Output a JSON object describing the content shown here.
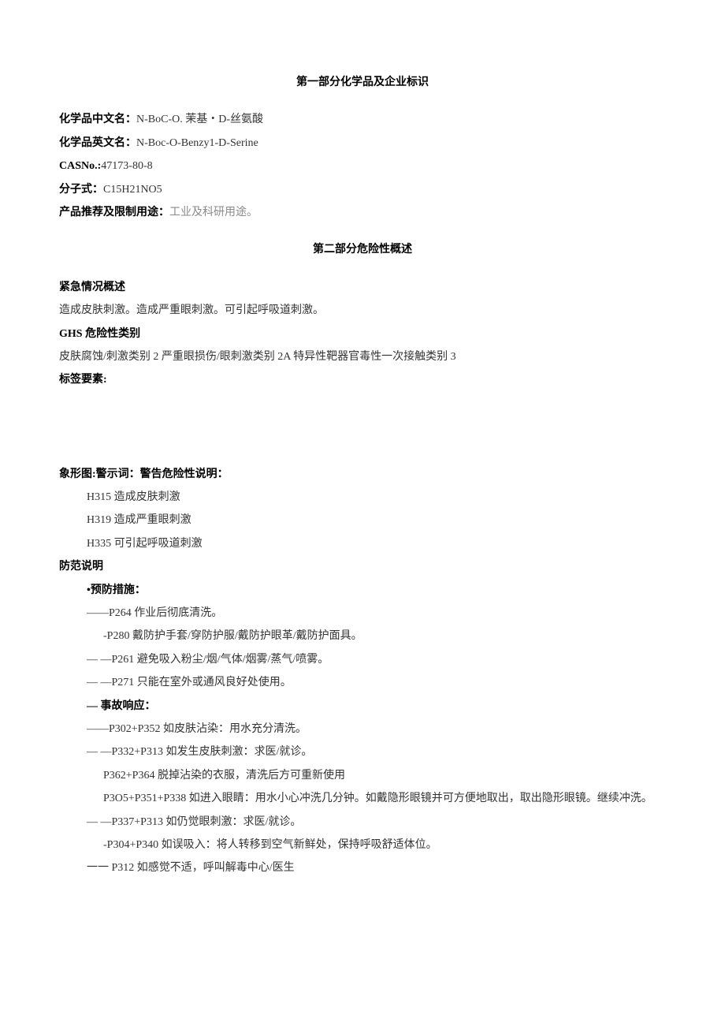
{
  "section1": {
    "title": "第一部分化学品及企业标识",
    "name_cn_label": "化学品中文名：",
    "name_cn_value": "N-BoC-O. 茉基・D-丝氨酸",
    "name_en_label": "化学品英文名：",
    "name_en_value": "N-Boc-O-Benzy1-D-Serine",
    "cas_label": "CASNo.:",
    "cas_value": "47173-80-8",
    "formula_label": "分子式：",
    "formula_value": "C15H21NO5",
    "use_label": "产品推荐及限制用途：",
    "use_value": "工业及科研用途。"
  },
  "section2": {
    "title": "第二部分危险性概述",
    "emergency_label": "紧急情况概述",
    "emergency_text": "造成皮肤刺激。造成严重眼刺激。可引起呼吸道刺激。",
    "ghs_label": "GHS 危险性类别",
    "ghs_text": "皮肤腐蚀/刺激类别 2 严重眼损伤/眼刺激类别 2A 特异性靶器官毒性一次接触类别 3",
    "label_elements": "标签要素:",
    "pictogram_line": "象形图:警示词：警告危险性说明：",
    "hazard_statements": [
      "H315 造成皮肤刺激",
      "H319 造成严重眼刺激",
      "H335 可引起呼吸道刺激"
    ],
    "precaution_label": "防范说明",
    "prevention_label": "•预防措施：",
    "prevention": [
      "——P264 作业后彻底清洗。",
      "-P280 戴防护手套/穿防护服/戴防护眼革/戴防护面具。",
      "—  —P261 避免吸入粉尘/烟/气体/烟雾/蒸气/喷雾。",
      "—   —P271 只能在室外或通风良好处使用。"
    ],
    "response_label": "— 事故响应：",
    "response": [
      "——P302+P352 如皮肤沾染：用水充分清洗。",
      "—   —P332+P313 如发生皮肤刺激：求医/就诊。",
      "P362+P364 脱掉沾染的衣服，清洗后方可重新使用",
      "P3O5+P351+P338 如进入眼睛：用水小心冲洗几分钟。如戴隐形眼镜并可方便地取出，取出隐形眼镜。继续冲洗。",
      "—   —P337+P313 如仍觉眼刺激：求医/就诊。",
      "-P304+P340 如误吸入：将人转移到空气新鲜处，保持呼吸舒适体位。",
      "一一 P312 如感觉不适，呼叫解毒中心/医生"
    ]
  }
}
